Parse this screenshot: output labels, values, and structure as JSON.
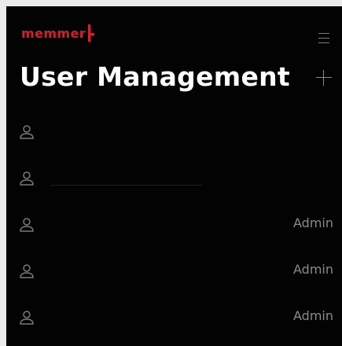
{
  "brand": {
    "name": "memmer",
    "accent": "#d1202f"
  },
  "header": {
    "title": "User Management",
    "menu_icon": "hamburger-menu-icon",
    "add_icon": "plus-icon"
  },
  "users": [
    {
      "name": "",
      "role": "",
      "icon": "user-icon"
    },
    {
      "name": "",
      "role": "",
      "icon": "user-icon"
    },
    {
      "name": "",
      "role": "Admin",
      "icon": "user-icon"
    },
    {
      "name": "",
      "role": "Admin",
      "icon": "user-icon"
    },
    {
      "name": "",
      "role": "Admin",
      "icon": "user-icon"
    }
  ]
}
